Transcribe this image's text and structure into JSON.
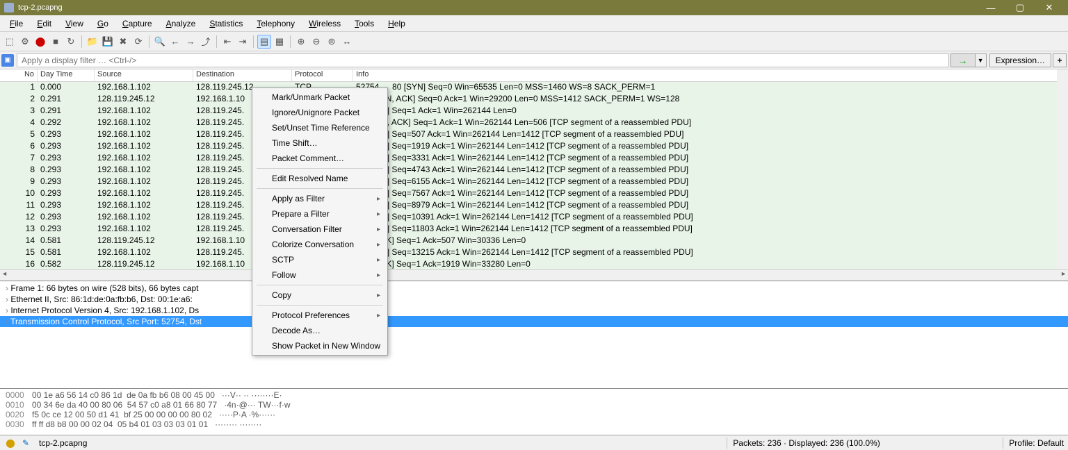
{
  "title": "tcp-2.pcapng",
  "menu": [
    "File",
    "Edit",
    "View",
    "Go",
    "Capture",
    "Analyze",
    "Statistics",
    "Telephony",
    "Wireless",
    "Tools",
    "Help"
  ],
  "filter_placeholder": "Apply a display filter … <Ctrl-/>",
  "expression_label": "Expression…",
  "columns": {
    "no": "No",
    "dt": "Day Time",
    "src": "Source",
    "dst": "Destination",
    "proto": "Protocol",
    "info": "Info"
  },
  "rows": [
    {
      "no": 1,
      "dt": "0.000",
      "src": "192.168.1.102",
      "dst": "128.119.245.12",
      "proto": "TCP",
      "info": "52754 → 80 [SYN] Seq=0 Win=65535 Len=0 MSS=1460 WS=8 SACK_PERM=1",
      "sel": true
    },
    {
      "no": 2,
      "dt": "0.291",
      "src": "128.119.245.12",
      "dst": "192.168.1.10",
      "proto": "",
      "info": "754 [SYN, ACK] Seq=0 Ack=1 Win=29200 Len=0 MSS=1412 SACK_PERM=1 WS=128"
    },
    {
      "no": 3,
      "dt": "0.291",
      "src": "192.168.1.102",
      "dst": "128.119.245.",
      "proto": "",
      "info": "80 [ACK] Seq=1 Ack=1 Win=262144 Len=0"
    },
    {
      "no": 4,
      "dt": "0.292",
      "src": "192.168.1.102",
      "dst": "128.119.245.",
      "proto": "",
      "info": "80 [PSH, ACK] Seq=1 Ack=1 Win=262144 Len=506 [TCP segment of a reassembled PDU]"
    },
    {
      "no": 5,
      "dt": "0.293",
      "src": "192.168.1.102",
      "dst": "128.119.245.",
      "proto": "",
      "info": "80 [ACK] Seq=507 Ack=1 Win=262144 Len=1412 [TCP segment of a reassembled PDU]"
    },
    {
      "no": 6,
      "dt": "0.293",
      "src": "192.168.1.102",
      "dst": "128.119.245.",
      "proto": "",
      "info": "80 [ACK] Seq=1919 Ack=1 Win=262144 Len=1412 [TCP segment of a reassembled PDU]"
    },
    {
      "no": 7,
      "dt": "0.293",
      "src": "192.168.1.102",
      "dst": "128.119.245.",
      "proto": "",
      "info": "80 [ACK] Seq=3331 Ack=1 Win=262144 Len=1412 [TCP segment of a reassembled PDU]"
    },
    {
      "no": 8,
      "dt": "0.293",
      "src": "192.168.1.102",
      "dst": "128.119.245.",
      "proto": "",
      "info": "80 [ACK] Seq=4743 Ack=1 Win=262144 Len=1412 [TCP segment of a reassembled PDU]"
    },
    {
      "no": 9,
      "dt": "0.293",
      "src": "192.168.1.102",
      "dst": "128.119.245.",
      "proto": "",
      "info": "80 [ACK] Seq=6155 Ack=1 Win=262144 Len=1412 [TCP segment of a reassembled PDU]"
    },
    {
      "no": 10,
      "dt": "0.293",
      "src": "192.168.1.102",
      "dst": "128.119.245.",
      "proto": "",
      "info": "80 [ACK] Seq=7567 Ack=1 Win=262144 Len=1412 [TCP segment of a reassembled PDU]"
    },
    {
      "no": 11,
      "dt": "0.293",
      "src": "192.168.1.102",
      "dst": "128.119.245.",
      "proto": "",
      "info": "80 [ACK] Seq=8979 Ack=1 Win=262144 Len=1412 [TCP segment of a reassembled PDU]"
    },
    {
      "no": 12,
      "dt": "0.293",
      "src": "192.168.1.102",
      "dst": "128.119.245.",
      "proto": "",
      "info": "80 [ACK] Seq=10391 Ack=1 Win=262144 Len=1412 [TCP segment of a reassembled PDU]"
    },
    {
      "no": 13,
      "dt": "0.293",
      "src": "192.168.1.102",
      "dst": "128.119.245.",
      "proto": "",
      "info": "80 [ACK] Seq=11803 Ack=1 Win=262144 Len=1412 [TCP segment of a reassembled PDU]"
    },
    {
      "no": 14,
      "dt": "0.581",
      "src": "128.119.245.12",
      "dst": "192.168.1.10",
      "proto": "",
      "info": "754 [ACK] Seq=1 Ack=507 Win=30336 Len=0"
    },
    {
      "no": 15,
      "dt": "0.581",
      "src": "192.168.1.102",
      "dst": "128.119.245.",
      "proto": "",
      "info": "80 [ACK] Seq=13215 Ack=1 Win=262144 Len=1412 [TCP segment of a reassembled PDU]"
    },
    {
      "no": 16,
      "dt": "0.582",
      "src": "128.119.245.12",
      "dst": "192.168.1.10",
      "proto": "",
      "info": "754 [ACK] Seq=1 Ack=1919 Win=33280 Len=0"
    }
  ],
  "context_items": [
    {
      "t": "Mark/Unmark Packet"
    },
    {
      "t": "Ignore/Unignore Packet"
    },
    {
      "t": "Set/Unset Time Reference"
    },
    {
      "t": "Time Shift…"
    },
    {
      "t": "Packet Comment…"
    },
    {
      "sep": true
    },
    {
      "t": "Edit Resolved Name"
    },
    {
      "sep": true
    },
    {
      "t": "Apply as Filter",
      "sub": true
    },
    {
      "t": "Prepare a Filter",
      "sub": true
    },
    {
      "t": "Conversation Filter",
      "sub": true
    },
    {
      "t": "Colorize Conversation",
      "sub": true
    },
    {
      "t": "SCTP",
      "sub": true
    },
    {
      "t": "Follow",
      "sub": true
    },
    {
      "sep": true
    },
    {
      "t": "Copy",
      "sub": true
    },
    {
      "sep": true
    },
    {
      "t": "Protocol Preferences",
      "sub": true
    },
    {
      "t": "Decode As…"
    },
    {
      "t": "Show Packet in New Window"
    }
  ],
  "details": [
    {
      "t": "Frame 1: 66 bytes on wire (528 bits), 66 bytes capt"
    },
    {
      "t": "Ethernet II, Src: 86:1d:de:0a:fb:b6, Dst: 00:1e:a6:"
    },
    {
      "t": "Internet Protocol Version 4, Src: 192.168.1.102, Ds"
    },
    {
      "t": "Transmission Control Protocol, Src Port: 52754, Dst",
      "sel": true
    }
  ],
  "hex": [
    {
      "off": "0000",
      "b": "00 1e a6 56 14 c0 86 1d  de 0a fb b6 08 00 45 00",
      "a": "···V·· ·· ········E·"
    },
    {
      "off": "0010",
      "b": "00 34 6e da 40 00 80 06  54 57 c0 a8 01 66 80 77",
      "a": "·4n·@··· TW···f·w"
    },
    {
      "off": "0020",
      "b": "f5 0c ce 12 00 50 d1 41  bf 25 00 00 00 00 80 02",
      "a": "·····P·A ·%······"
    },
    {
      "off": "0030",
      "b": "ff ff d8 b8 00 00 02 04  05 b4 01 03 03 03 01 01",
      "a": "········ ········"
    }
  ],
  "status": {
    "file": "tcp-2.pcapng",
    "packets": "Packets: 236 · Displayed: 236 (100.0%)",
    "profile": "Profile: Default"
  }
}
